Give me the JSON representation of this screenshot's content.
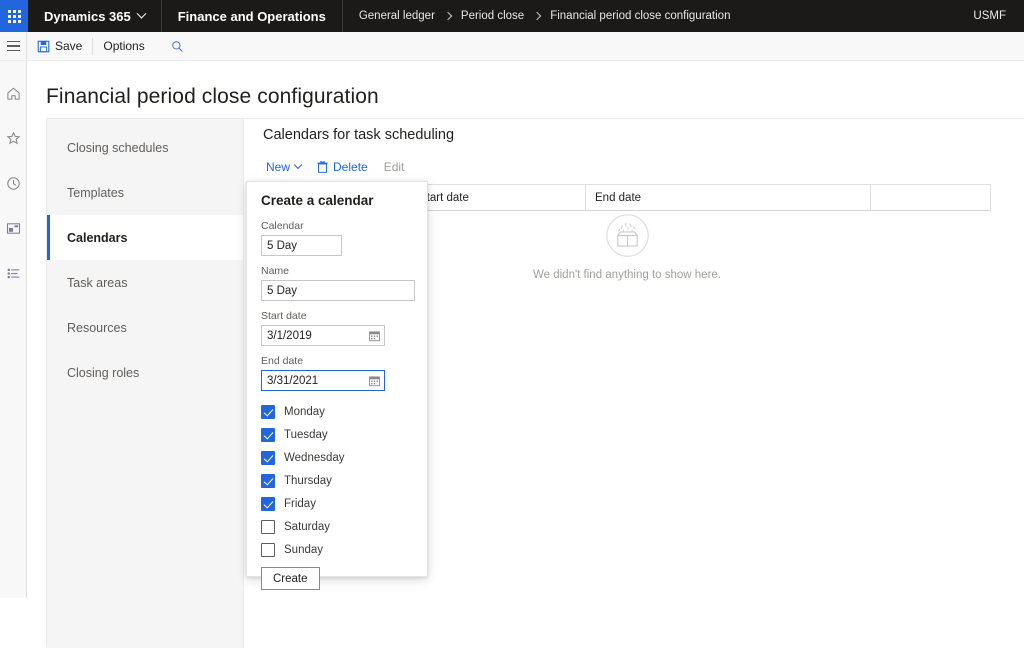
{
  "topbar": {
    "waffle_icon": "waffle-grid-icon",
    "product": "Dynamics 365",
    "app": "Finance and Operations",
    "breadcrumb": [
      "General ledger",
      "Period close",
      "Financial period close configuration"
    ],
    "company": "USMF",
    "background_color": "#1b1a19",
    "accent_color": "#2266dd"
  },
  "commandbar": {
    "hamburger_icon": "hamburger-icon",
    "save_label": "Save",
    "save_icon": "save-floppy-icon",
    "options_label": "Options",
    "search_icon": "search-icon"
  },
  "rail": {
    "items": [
      {
        "icon": "home-icon",
        "name": "home"
      },
      {
        "icon": "star-icon",
        "name": "favorites"
      },
      {
        "icon": "clock-icon",
        "name": "recent"
      },
      {
        "icon": "workspace-icon",
        "name": "workspaces"
      },
      {
        "icon": "list-icon",
        "name": "modules"
      }
    ]
  },
  "page": {
    "title": "Financial period close configuration"
  },
  "nav": {
    "items": [
      {
        "label": "Closing schedules",
        "selected": false
      },
      {
        "label": "Templates",
        "selected": false
      },
      {
        "label": "Calendars",
        "selected": true
      },
      {
        "label": "Task areas",
        "selected": false
      },
      {
        "label": "Resources",
        "selected": false
      },
      {
        "label": "Closing roles",
        "selected": false
      }
    ],
    "selected_accent": "#2266dd"
  },
  "main": {
    "title": "Calendars for task scheduling",
    "toolbar": {
      "new_label": "New",
      "new_chevron_icon": "chevron-down-icon",
      "delete_label": "Delete",
      "delete_icon": "trash-icon",
      "edit_label": "Edit",
      "edit_disabled": true
    },
    "grid": {
      "columns": [
        "",
        "Start date",
        "End date"
      ],
      "rows": []
    },
    "empty_state": {
      "icon": "empty-box-icon",
      "message": "We didn't find anything to show here."
    }
  },
  "dropdown": {
    "title": "Create a calendar",
    "fields": [
      {
        "label": "Calendar",
        "value": "5 Day",
        "placeholder": "",
        "focused": false,
        "has_calendar_icon": false
      },
      {
        "label": "Name",
        "value": "5 Day",
        "placeholder": "",
        "focused": false,
        "has_calendar_icon": false
      },
      {
        "label": "Start date",
        "value": "3/1/2019",
        "placeholder": "",
        "focused": false,
        "has_calendar_icon": true
      },
      {
        "label": "End date",
        "value": "3/31/2021",
        "placeholder": "",
        "focused": true,
        "has_calendar_icon": true
      }
    ],
    "days": [
      {
        "label": "Monday",
        "checked": true
      },
      {
        "label": "Tuesday",
        "checked": true
      },
      {
        "label": "Wednesday",
        "checked": true
      },
      {
        "label": "Thursday",
        "checked": true
      },
      {
        "label": "Friday",
        "checked": true
      },
      {
        "label": "Saturday",
        "checked": false
      },
      {
        "label": "Sunday",
        "checked": false
      }
    ],
    "create_label": "Create"
  }
}
